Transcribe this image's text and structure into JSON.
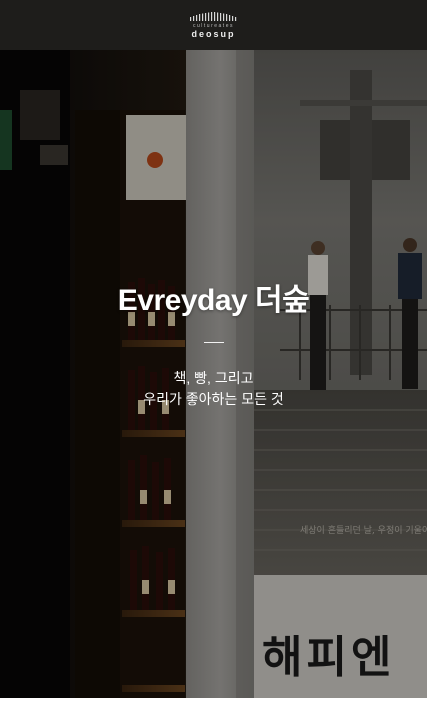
{
  "header": {
    "logo_tag": "cultureates",
    "logo_name": "deosup"
  },
  "hero": {
    "title": "Evreyday 더숲",
    "tagline_line1": "책, 빵, 그리고",
    "tagline_line2": "우리가 좋아하는 모든 것"
  },
  "poster": {
    "caption": "세상이 흔들리던 날, 우정이 기울어",
    "big_text": "해피엔"
  },
  "colors": {
    "header_bg": "#1e1d1b",
    "text": "#ffffff"
  }
}
